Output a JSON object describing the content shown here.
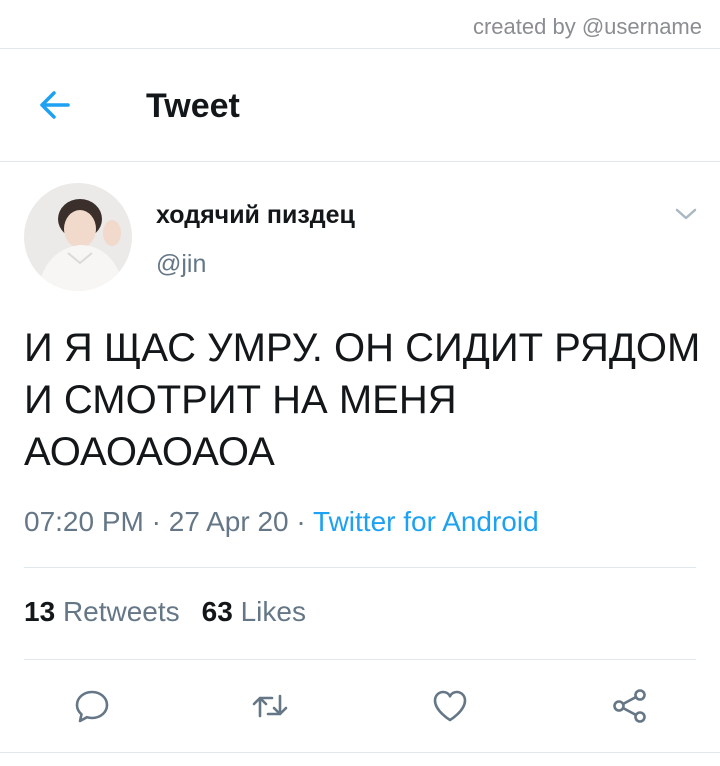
{
  "watermark": "created by @username",
  "header": {
    "title": "Tweet",
    "back_icon": "arrow-left-icon"
  },
  "tweet": {
    "display_name": "ходячий пиздец",
    "handle": "@jin",
    "text": "И Я ЩАС УМРУ. ОН СИДИТ РЯДОМ И СМОТРИТ НА МЕНЯ АОАОАОАОА",
    "time": "07:20 PM",
    "date": "27 Apr 20",
    "separator": "·",
    "source": "Twitter for Android",
    "retweets_count": "13",
    "retweets_label": "Retweets",
    "likes_count": "63",
    "likes_label": "Likes"
  },
  "actions": [
    "reply-icon",
    "retweet-icon",
    "like-icon",
    "share-icon"
  ],
  "colors": {
    "accent": "#1da1f2",
    "text_primary": "#14171a",
    "text_secondary": "#657786",
    "divider": "#e1e8ed"
  }
}
